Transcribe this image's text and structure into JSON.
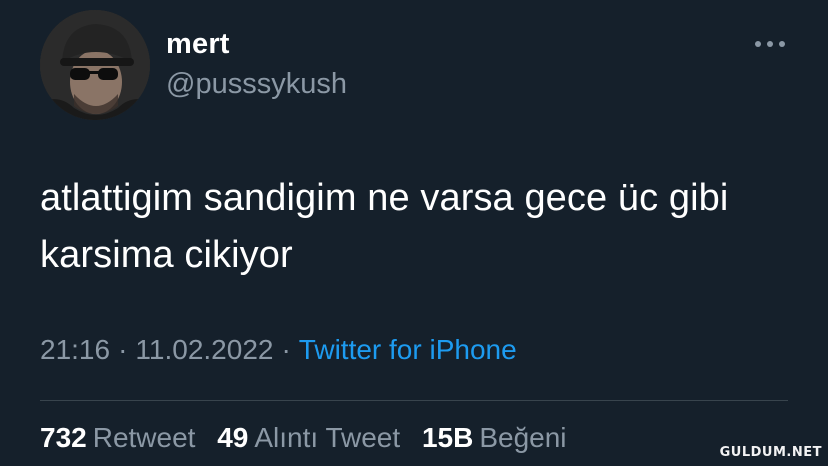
{
  "author": {
    "display_name": "mert",
    "handle": "@pusssykush"
  },
  "tweet": {
    "text": "atlattigim sandigim ne varsa gece üc gibi karsima cikiyor",
    "time": "21:16",
    "date": "11.02.2022",
    "source": "Twitter for iPhone",
    "separator": "·"
  },
  "stats": {
    "retweets": {
      "count": "732",
      "label": "Retweet"
    },
    "quotes": {
      "count": "49",
      "label": "Alıntı Tweet"
    },
    "likes": {
      "count": "15B",
      "label": "Beğeni"
    }
  },
  "watermark": "GULDUM.NET",
  "icons": {
    "more": "more-horizontal-icon",
    "avatar": "profile-photo"
  },
  "colors": {
    "background": "#15202b",
    "text_primary": "#ffffff",
    "text_secondary": "#8b98a5",
    "link": "#1d9bf0",
    "divider": "#38444d"
  }
}
